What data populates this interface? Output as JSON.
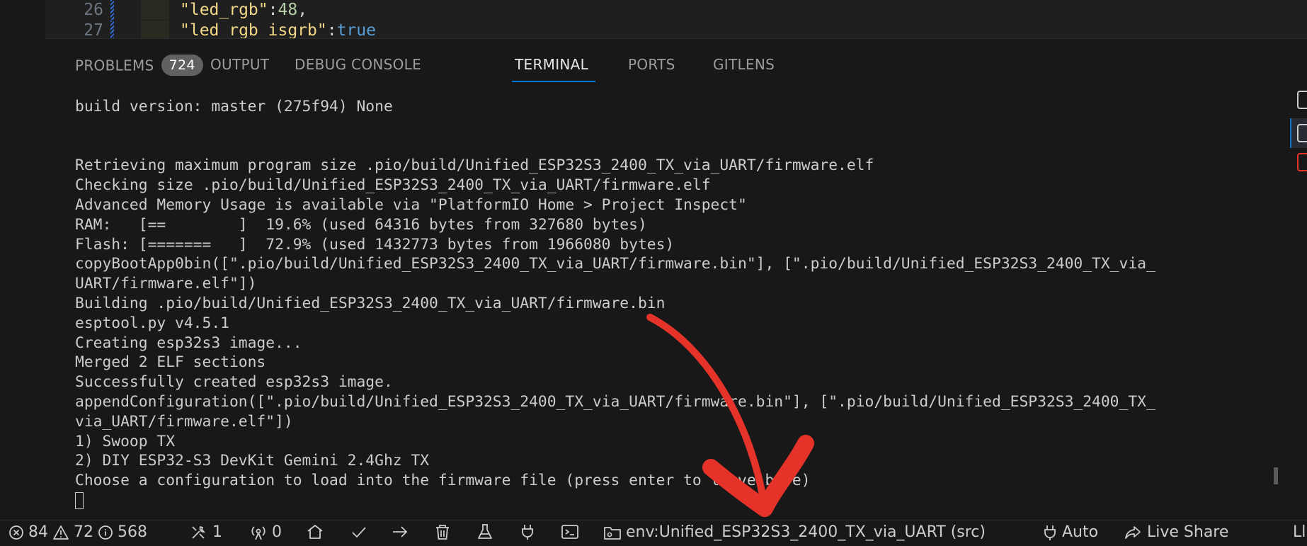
{
  "editor": {
    "lines": [
      {
        "number": "26",
        "key": "\"led_rgb\"",
        "sep": ":",
        "value": "48",
        "trail": ","
      },
      {
        "number": "27",
        "key": "\"led_rgb_isgrb\"",
        "sep": ":",
        "value": "true",
        "trail": ""
      }
    ]
  },
  "panel": {
    "tabs": [
      {
        "label": "PROBLEMS",
        "badge": "724"
      },
      {
        "label": "OUTPUT"
      },
      {
        "label": "DEBUG CONSOLE"
      },
      {
        "label": "TERMINAL",
        "active": true
      },
      {
        "label": "PORTS"
      },
      {
        "label": "GITLENS"
      }
    ]
  },
  "terminal": {
    "lines": [
      "build version: master (275f94) None",
      "",
      "",
      "Retrieving maximum program size .pio/build/Unified_ESP32S3_2400_TX_via_UART/firmware.elf",
      "Checking size .pio/build/Unified_ESP32S3_2400_TX_via_UART/firmware.elf",
      "Advanced Memory Usage is available via \"PlatformIO Home > Project Inspect\"",
      "RAM:   [==        ]  19.6% (used 64316 bytes from 327680 bytes)",
      "Flash: [=======   ]  72.9% (used 1432773 bytes from 1966080 bytes)",
      "copyBootApp0bin([\".pio/build/Unified_ESP32S3_2400_TX_via_UART/firmware.bin\"], [\".pio/build/Unified_ESP32S3_2400_TX_via_",
      "UART/firmware.elf\"])",
      "Building .pio/build/Unified_ESP32S3_2400_TX_via_UART/firmware.bin",
      "esptool.py v4.5.1",
      "Creating esp32s3 image...",
      "Merged 2 ELF sections",
      "Successfully created esp32s3 image.",
      "appendConfiguration([\".pio/build/Unified_ESP32S3_2400_TX_via_UART/firmware.bin\"], [\".pio/build/Unified_ESP32S3_2400_TX_",
      "via_UART/firmware.elf\"])",
      "1) Swoop TX",
      "2) DIY ESP32-S3 DevKit Gemini 2.4Ghz TX",
      "Choose a configuration to load into the firmware file (press enter to leave bare)"
    ]
  },
  "statusbar": {
    "errors": "84",
    "warnings": "72",
    "infos": "568",
    "tools_count": "1",
    "ports_count": "0",
    "env": "env:Unified_ESP32S3_2400_TX_via_UART (src)",
    "auto": "Auto",
    "live_share": "Live Share",
    "right_edge": "Ll"
  },
  "colors": {
    "background": "#181818",
    "accent": "#0078d4",
    "annotation_arrow": "#e5332a"
  }
}
